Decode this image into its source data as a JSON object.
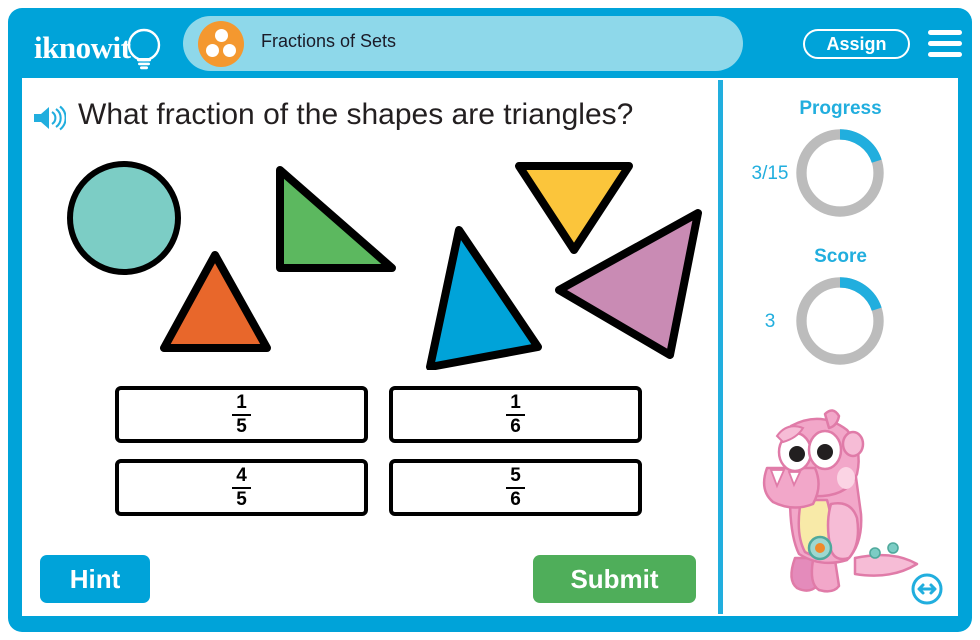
{
  "brand": {
    "logo_text": "iknowit",
    "logo_icon": "lightbulb-icon"
  },
  "header": {
    "lesson_title": "Fractions of Sets",
    "lesson_badge_icon": "three-dots-circle-icon",
    "assign_label": "Assign",
    "menu_icon": "hamburger-menu-icon",
    "bar_color": "#00a3d9",
    "title_panel_color": "#8ed8ea",
    "badge_color": "#f4982f"
  },
  "question": {
    "text": "What fraction of the shapes are triangles?",
    "audio_icon": "speaker-icon"
  },
  "shapes": [
    {
      "name": "circle",
      "kind": "circle",
      "color": "#7ccdc5"
    },
    {
      "name": "green-triangle",
      "kind": "triangle",
      "color": "#5cb85f"
    },
    {
      "name": "orange-triangle",
      "kind": "triangle",
      "color": "#e8672b"
    },
    {
      "name": "yellow-triangle",
      "kind": "triangle",
      "color": "#fbc53b"
    },
    {
      "name": "blue-triangle",
      "kind": "triangle",
      "color": "#00a3d9"
    },
    {
      "name": "pink-triangle",
      "kind": "triangle",
      "color": "#c98bb4"
    }
  ],
  "answers": [
    {
      "numerator": "1",
      "denominator": "5"
    },
    {
      "numerator": "1",
      "denominator": "6"
    },
    {
      "numerator": "4",
      "denominator": "5"
    },
    {
      "numerator": "5",
      "denominator": "6"
    }
  ],
  "actions": {
    "hint_label": "Hint",
    "hint_color": "#00a3d9",
    "submit_label": "Submit",
    "submit_color": "#4fae5a"
  },
  "sidebar": {
    "progress": {
      "label": "Progress",
      "value_text": "3/15",
      "completed": 3,
      "total": 15,
      "percent": 20,
      "fill_color": "#21aede",
      "track_color": "#bcbcbc"
    },
    "score": {
      "label": "Score",
      "value_text": "3",
      "percent": 20,
      "fill_color": "#21aede",
      "track_color": "#bcbcbc"
    },
    "mascot": {
      "name": "pink-monster-mascot",
      "color": "#f2a7c9"
    },
    "resize_icon": "resize-horizontal-icon"
  }
}
